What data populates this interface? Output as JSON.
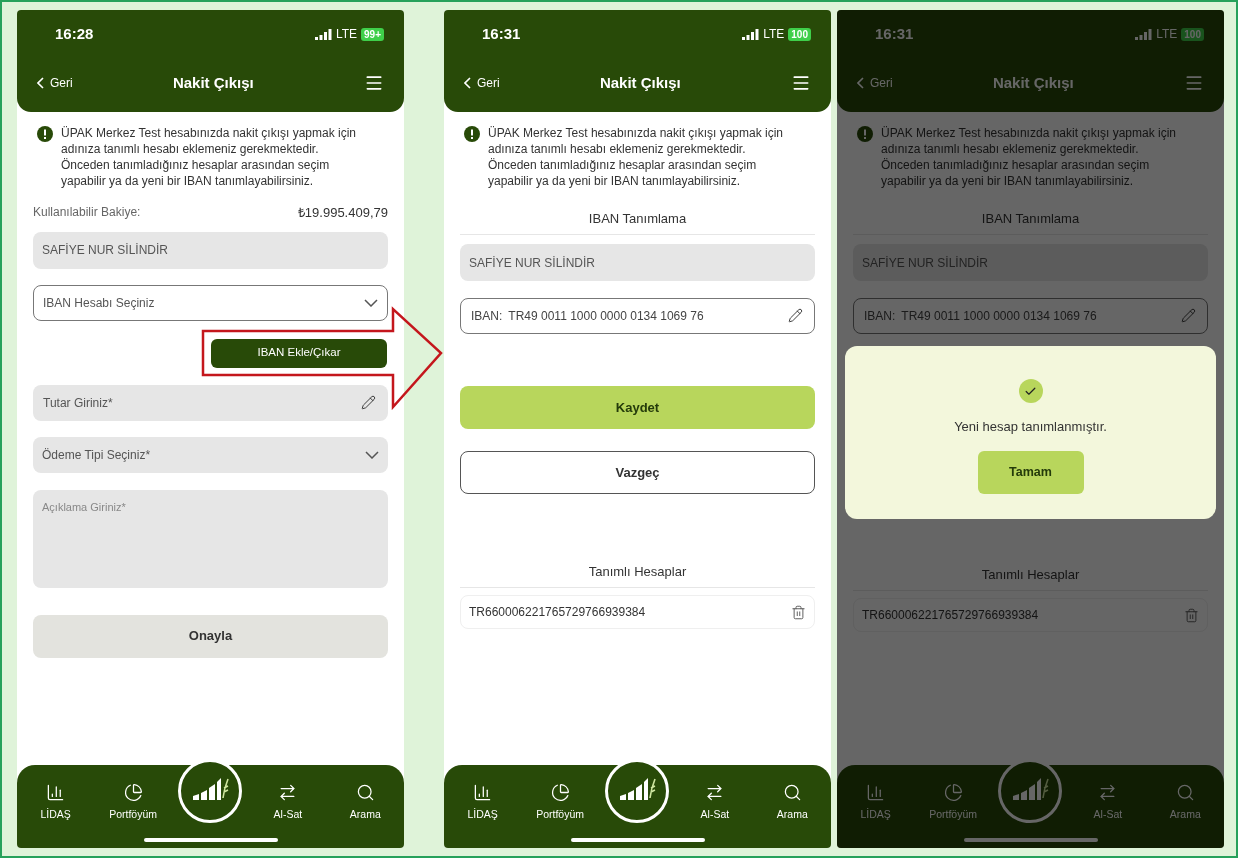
{
  "screens": [
    {
      "status": {
        "time": "16:28",
        "network": "LTE",
        "battery": "99+"
      },
      "header": {
        "back": "Geri",
        "title": "Nakit Çıkışı"
      },
      "notice": "ÜPAK Merkez Test hesabınızda nakit çıkışı yapmak için adınıza tanımlı hesabı eklemeniz gerekmektedir. Önceden tanımladığınız hesaplar arasından seçim yapabilir ya da yeni bir IBAN tanımlayabilirsiniz.",
      "content": [
        {
          "kind": "balance",
          "label": "Kullanılabilir Bakiye:",
          "value": "₺19.995.409,79"
        },
        {
          "kind": "readonly",
          "value": "SAFİYE NUR SİLİNDİR"
        },
        {
          "kind": "select",
          "placeholder": "IBAN Hesabı Seçiniz",
          "outlined": true
        },
        {
          "kind": "action",
          "label": "IBAN Ekle/Çıkar"
        },
        {
          "kind": "input",
          "placeholder": "Tutar Giriniz*",
          "outlined": false
        },
        {
          "kind": "select",
          "placeholder": "Ödeme Tipi Seçiniz*",
          "outlined": false
        },
        {
          "kind": "textarea",
          "placeholder": "Açıklama Giriniz*"
        },
        {
          "kind": "submit",
          "label": "Onayla"
        }
      ],
      "nav": [
        {
          "label": "LİDAŞ",
          "kind": "chart"
        },
        {
          "label": "Portföyüm",
          "kind": "pie"
        },
        {
          "kind": "logo"
        },
        {
          "label": "Al-Sat",
          "kind": "swap"
        },
        {
          "label": "Arama",
          "kind": "search"
        }
      ]
    },
    {
      "status": {
        "time": "16:31",
        "network": "LTE",
        "battery": "100"
      },
      "header": {
        "back": "Geri",
        "title": "Nakit Çıkışı"
      },
      "notice": "ÜPAK Merkez Test hesabınızda nakit çıkışı yapmak için adınıza tanımlı hesabı eklemeniz gerekmektedir. Önceden tanımladığınız hesaplar arasından seçim yapabilir ya da yeni bir IBAN tanımlayabilirsiniz.",
      "content": [
        {
          "kind": "heading",
          "text": "IBAN Tanımlama"
        },
        {
          "kind": "readonly",
          "value": "SAFİYE NUR SİLİNDİR"
        },
        {
          "kind": "input",
          "label": "IBAN:",
          "value": "TR49 0011 1000 0000 0134 1069 76",
          "outlined": true
        },
        {
          "kind": "save",
          "label": "Kaydet"
        },
        {
          "kind": "cancel",
          "label": "Vazgeç"
        },
        {
          "kind": "heading",
          "text": "Tanımlı Hesaplar"
        },
        {
          "kind": "account",
          "value": "TR660006221765729766939384"
        }
      ],
      "nav": [
        {
          "label": "LİDAŞ",
          "kind": "chart"
        },
        {
          "label": "Portföyüm",
          "kind": "pie"
        },
        {
          "kind": "logo"
        },
        {
          "label": "Al-Sat",
          "kind": "swap"
        },
        {
          "label": "Arama",
          "kind": "search"
        }
      ]
    },
    {
      "status": {
        "time": "16:31",
        "network": "LTE",
        "battery": "100"
      },
      "header": {
        "back": "Geri",
        "title": "Nakit Çıkışı"
      },
      "notice": "ÜPAK Merkez Test hesabınızda nakit çıkışı yapmak için adınıza tanımlı hesabı eklemeniz gerekmektedir. Önceden tanımladığınız hesaplar arasından seçim yapabilir ya da yeni bir IBAN tanımlayabilirsiniz.",
      "content": [
        {
          "kind": "heading",
          "text": "IBAN Tanımlama"
        },
        {
          "kind": "readonly",
          "value": "SAFİYE NUR SİLİNDİR"
        },
        {
          "kind": "input",
          "label": "IBAN:",
          "value": "TR49 0011 1000 0000 0134 1069 76",
          "outlined": true
        },
        {
          "kind": "dialog",
          "message": "Yeni hesap tanımlanmıştır.",
          "button": "Tamam"
        },
        {
          "kind": "heading",
          "text": "Tanımlı Hesaplar"
        },
        {
          "kind": "account",
          "value": "TR660006221765729766939384"
        }
      ],
      "nav": [
        {
          "label": "LİDAŞ",
          "kind": "chart"
        },
        {
          "label": "Portföyüm",
          "kind": "pie"
        },
        {
          "kind": "logo"
        },
        {
          "label": "Al-Sat",
          "kind": "swap"
        },
        {
          "label": "Arama",
          "kind": "search"
        }
      ]
    }
  ]
}
